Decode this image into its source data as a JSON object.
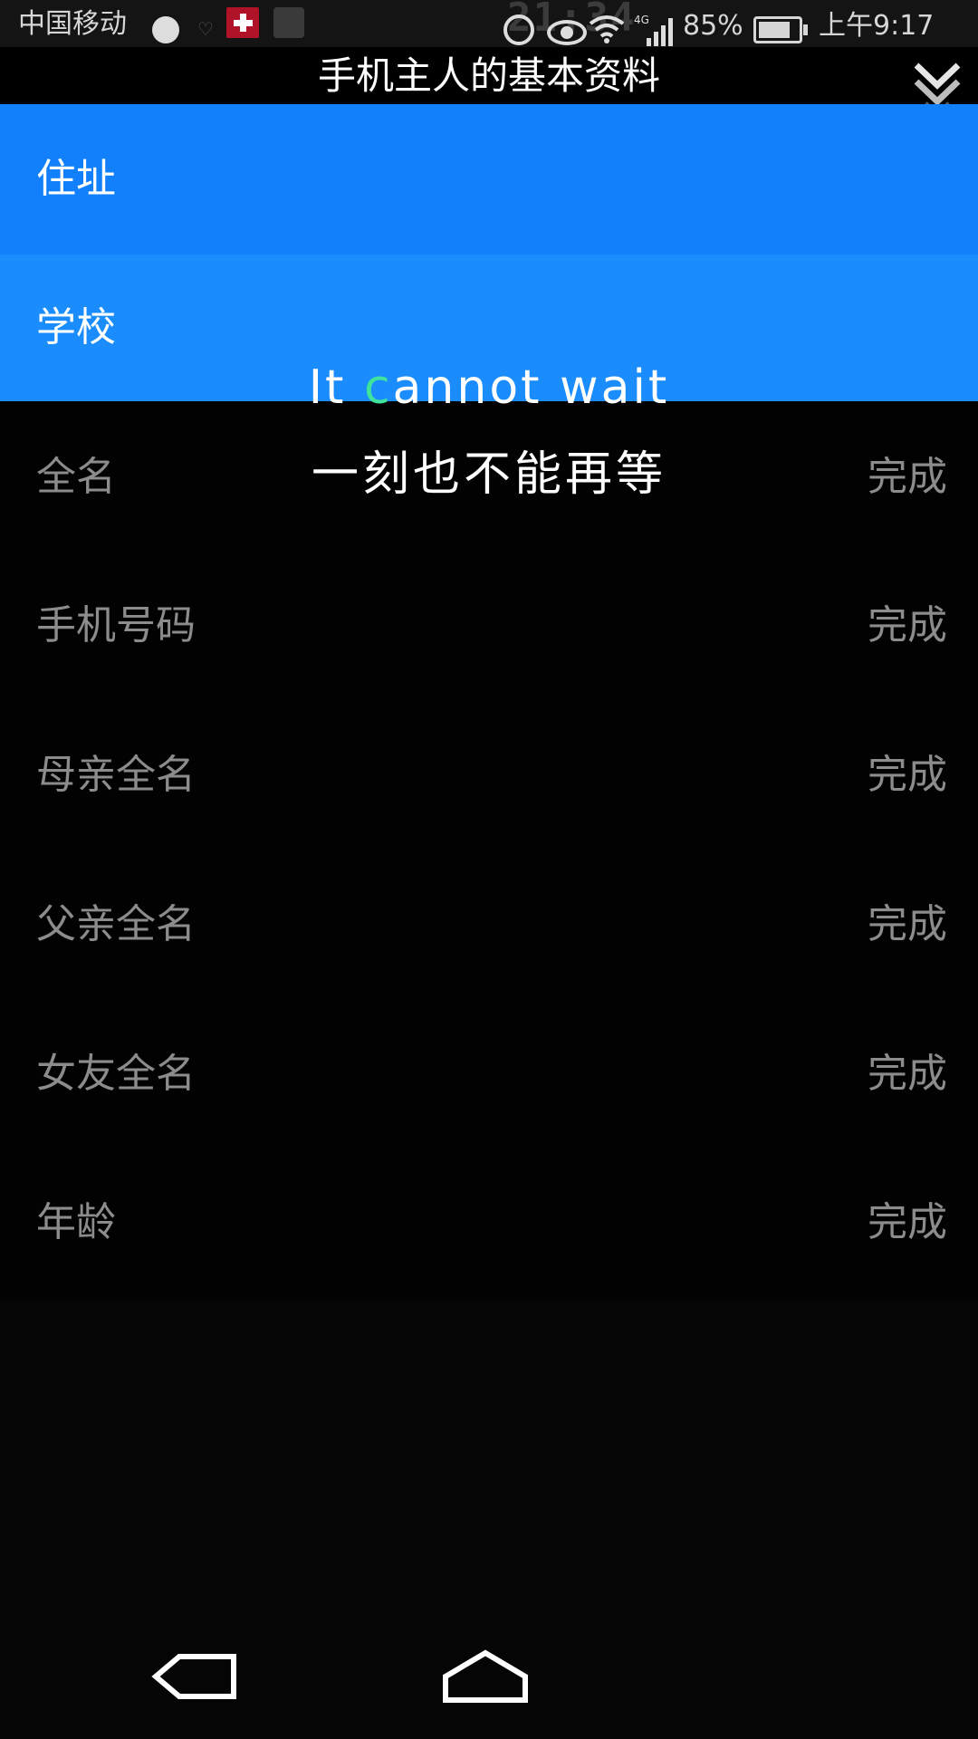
{
  "status_bar": {
    "carrier": "中国移动",
    "battery_percent": "85%",
    "network": "4G",
    "time": "上午9:17",
    "overlay_clock": "21:34"
  },
  "header": {
    "title": "手机主人的基本资料"
  },
  "rows": [
    {
      "label": "住址",
      "status": ""
    },
    {
      "label": "学校",
      "status": ""
    },
    {
      "label": "全名",
      "status": "完成"
    },
    {
      "label": "手机号码",
      "status": "完成"
    },
    {
      "label": "母亲全名",
      "status": "完成"
    },
    {
      "label": "父亲全名",
      "status": "完成"
    },
    {
      "label": "女友全名",
      "status": "完成"
    },
    {
      "label": "年龄",
      "status": "完成"
    }
  ],
  "overlay": {
    "lyric_en_prefix": "It ",
    "lyric_en_highlight": "c",
    "lyric_en_rest": "annot wait",
    "lyric_zh": "一刻也不能再等"
  },
  "colors": {
    "active_row": "#1180fa",
    "active_row_2": "#1a8cfb",
    "inactive_text": "#8c8c8c",
    "lyric_highlight": "#3fe39c"
  },
  "icons": {
    "collapse": "chevron-double-down-icon",
    "back": "back-icon",
    "home": "home-icon"
  }
}
